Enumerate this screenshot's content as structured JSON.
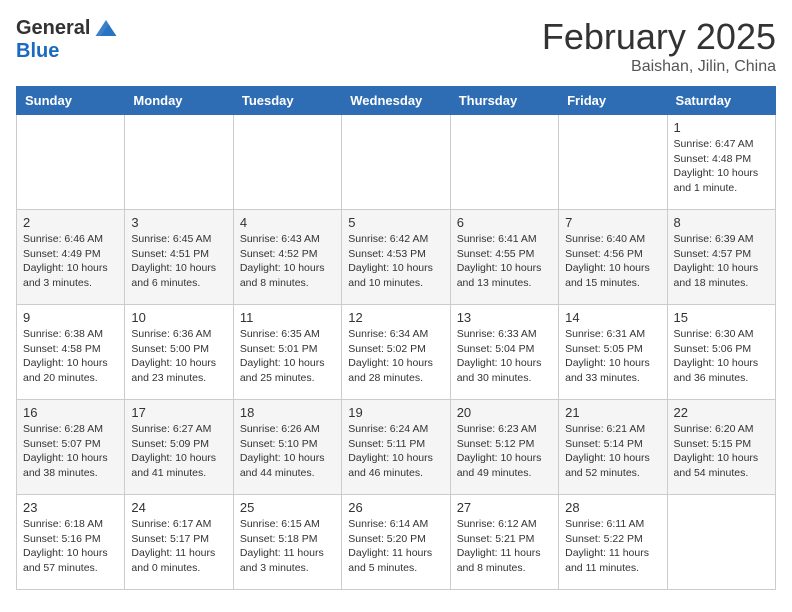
{
  "header": {
    "logo_general": "General",
    "logo_blue": "Blue",
    "month_title": "February 2025",
    "location": "Baishan, Jilin, China"
  },
  "weekdays": [
    "Sunday",
    "Monday",
    "Tuesday",
    "Wednesday",
    "Thursday",
    "Friday",
    "Saturday"
  ],
  "weeks": [
    [
      {
        "day": "",
        "info": ""
      },
      {
        "day": "",
        "info": ""
      },
      {
        "day": "",
        "info": ""
      },
      {
        "day": "",
        "info": ""
      },
      {
        "day": "",
        "info": ""
      },
      {
        "day": "",
        "info": ""
      },
      {
        "day": "1",
        "info": "Sunrise: 6:47 AM\nSunset: 4:48 PM\nDaylight: 10 hours and 1 minute."
      }
    ],
    [
      {
        "day": "2",
        "info": "Sunrise: 6:46 AM\nSunset: 4:49 PM\nDaylight: 10 hours and 3 minutes."
      },
      {
        "day": "3",
        "info": "Sunrise: 6:45 AM\nSunset: 4:51 PM\nDaylight: 10 hours and 6 minutes."
      },
      {
        "day": "4",
        "info": "Sunrise: 6:43 AM\nSunset: 4:52 PM\nDaylight: 10 hours and 8 minutes."
      },
      {
        "day": "5",
        "info": "Sunrise: 6:42 AM\nSunset: 4:53 PM\nDaylight: 10 hours and 10 minutes."
      },
      {
        "day": "6",
        "info": "Sunrise: 6:41 AM\nSunset: 4:55 PM\nDaylight: 10 hours and 13 minutes."
      },
      {
        "day": "7",
        "info": "Sunrise: 6:40 AM\nSunset: 4:56 PM\nDaylight: 10 hours and 15 minutes."
      },
      {
        "day": "8",
        "info": "Sunrise: 6:39 AM\nSunset: 4:57 PM\nDaylight: 10 hours and 18 minutes."
      }
    ],
    [
      {
        "day": "9",
        "info": "Sunrise: 6:38 AM\nSunset: 4:58 PM\nDaylight: 10 hours and 20 minutes."
      },
      {
        "day": "10",
        "info": "Sunrise: 6:36 AM\nSunset: 5:00 PM\nDaylight: 10 hours and 23 minutes."
      },
      {
        "day": "11",
        "info": "Sunrise: 6:35 AM\nSunset: 5:01 PM\nDaylight: 10 hours and 25 minutes."
      },
      {
        "day": "12",
        "info": "Sunrise: 6:34 AM\nSunset: 5:02 PM\nDaylight: 10 hours and 28 minutes."
      },
      {
        "day": "13",
        "info": "Sunrise: 6:33 AM\nSunset: 5:04 PM\nDaylight: 10 hours and 30 minutes."
      },
      {
        "day": "14",
        "info": "Sunrise: 6:31 AM\nSunset: 5:05 PM\nDaylight: 10 hours and 33 minutes."
      },
      {
        "day": "15",
        "info": "Sunrise: 6:30 AM\nSunset: 5:06 PM\nDaylight: 10 hours and 36 minutes."
      }
    ],
    [
      {
        "day": "16",
        "info": "Sunrise: 6:28 AM\nSunset: 5:07 PM\nDaylight: 10 hours and 38 minutes."
      },
      {
        "day": "17",
        "info": "Sunrise: 6:27 AM\nSunset: 5:09 PM\nDaylight: 10 hours and 41 minutes."
      },
      {
        "day": "18",
        "info": "Sunrise: 6:26 AM\nSunset: 5:10 PM\nDaylight: 10 hours and 44 minutes."
      },
      {
        "day": "19",
        "info": "Sunrise: 6:24 AM\nSunset: 5:11 PM\nDaylight: 10 hours and 46 minutes."
      },
      {
        "day": "20",
        "info": "Sunrise: 6:23 AM\nSunset: 5:12 PM\nDaylight: 10 hours and 49 minutes."
      },
      {
        "day": "21",
        "info": "Sunrise: 6:21 AM\nSunset: 5:14 PM\nDaylight: 10 hours and 52 minutes."
      },
      {
        "day": "22",
        "info": "Sunrise: 6:20 AM\nSunset: 5:15 PM\nDaylight: 10 hours and 54 minutes."
      }
    ],
    [
      {
        "day": "23",
        "info": "Sunrise: 6:18 AM\nSunset: 5:16 PM\nDaylight: 10 hours and 57 minutes."
      },
      {
        "day": "24",
        "info": "Sunrise: 6:17 AM\nSunset: 5:17 PM\nDaylight: 11 hours and 0 minutes."
      },
      {
        "day": "25",
        "info": "Sunrise: 6:15 AM\nSunset: 5:18 PM\nDaylight: 11 hours and 3 minutes."
      },
      {
        "day": "26",
        "info": "Sunrise: 6:14 AM\nSunset: 5:20 PM\nDaylight: 11 hours and 5 minutes."
      },
      {
        "day": "27",
        "info": "Sunrise: 6:12 AM\nSunset: 5:21 PM\nDaylight: 11 hours and 8 minutes."
      },
      {
        "day": "28",
        "info": "Sunrise: 6:11 AM\nSunset: 5:22 PM\nDaylight: 11 hours and 11 minutes."
      },
      {
        "day": "",
        "info": ""
      }
    ]
  ]
}
